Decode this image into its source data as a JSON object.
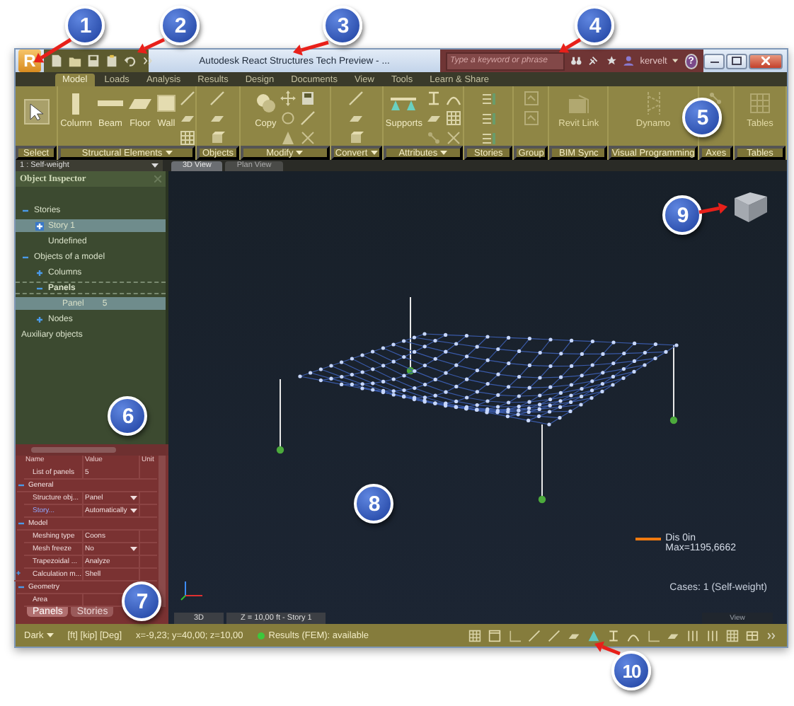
{
  "app_button": {
    "label": "R"
  },
  "window": {
    "title": "Autodesk React Structures Tech Preview - ..."
  },
  "search": {
    "placeholder": "Type a keyword or phrase"
  },
  "user": {
    "name": "kervelt"
  },
  "help": {
    "label": "?"
  },
  "tabs": [
    {
      "label": "Model",
      "selected": true
    },
    {
      "label": "Loads",
      "selected": false
    },
    {
      "label": "Analysis",
      "selected": false
    },
    {
      "label": "Results",
      "selected": false
    },
    {
      "label": "Design",
      "selected": false
    },
    {
      "label": "Documents",
      "selected": false
    },
    {
      "label": "View",
      "selected": false
    },
    {
      "label": "Tools",
      "selected": false
    },
    {
      "label": "Learn & Share",
      "selected": false
    }
  ],
  "ribbon_groups": [
    {
      "label": "Select",
      "menu": false,
      "buttons": [
        {
          "kind": "cursor"
        }
      ]
    },
    {
      "label": "Structural Elements",
      "menu": true,
      "buttons": [
        {
          "kind": "column",
          "label": "Column",
          "disabled": false
        },
        {
          "kind": "beam",
          "label": "Beam",
          "disabled": false
        },
        {
          "kind": "floor",
          "label": "Floor",
          "disabled": false
        },
        {
          "kind": "wall",
          "label": "Wall",
          "disabled": false
        }
      ]
    },
    {
      "label": "Objects",
      "menu": false
    },
    {
      "label": "Modify",
      "menu": true,
      "buttons": [
        {
          "kind": "copy",
          "label": "Copy",
          "disabled": false
        }
      ]
    },
    {
      "label": "Convert",
      "menu": true
    },
    {
      "label": "Attributes",
      "menu": true,
      "buttons": [
        {
          "kind": "supports",
          "label": "Supports",
          "disabled": false
        }
      ]
    },
    {
      "label": "Stories",
      "menu": false
    },
    {
      "label": "Group",
      "menu": false
    },
    {
      "label": "BIM Sync",
      "menu": false,
      "buttons": [
        {
          "kind": "revit",
          "label": "Revit Link",
          "disabled": true
        }
      ]
    },
    {
      "label": "Visual Programming",
      "menu": false,
      "buttons": [
        {
          "kind": "dynamo",
          "label": "Dynamo",
          "disabled": true
        }
      ]
    },
    {
      "label": "Axes",
      "menu": false
    },
    {
      "label": "Tables",
      "menu": false,
      "buttons": [
        {
          "kind": "tables",
          "label": "Tables",
          "disabled": true
        }
      ]
    }
  ],
  "load_case": {
    "value": "1 : Self-weight"
  },
  "view_tabs": [
    {
      "label": "3D View",
      "selected": true
    },
    {
      "label": "Plan View",
      "selected": false
    }
  ],
  "object_inspector": {
    "title": "Object Inspector",
    "tree": [
      {
        "label": "Stories",
        "expanded": true,
        "selected": false,
        "children": [
          {
            "label": "Story 1",
            "expanded": false,
            "selected": true
          },
          {
            "label": "Undefined",
            "selected": false
          }
        ]
      },
      {
        "label": "Objects of a model",
        "expanded": true,
        "selected": false,
        "children": [
          {
            "label": "Columns",
            "expanded": false,
            "selected": false
          },
          {
            "label": "Panels",
            "expanded": true,
            "selected": false,
            "active": true,
            "children": [
              {
                "label": "Panel",
                "count": "5",
                "selected": true
              }
            ]
          },
          {
            "label": "Nodes",
            "expanded": false,
            "selected": false
          }
        ]
      },
      {
        "label": "Auxiliary objects",
        "selected": false
      }
    ]
  },
  "properties": {
    "columns": [
      "Name",
      "Value",
      "Unit"
    ],
    "rows": [
      {
        "kind": "row",
        "name": "List of panels",
        "value": "5",
        "linked": false
      },
      {
        "kind": "section",
        "name": "General",
        "expanded": true
      },
      {
        "kind": "select",
        "name": "Structure obj...",
        "value": "Panel",
        "linked": false
      },
      {
        "kind": "select",
        "name": "Story...",
        "value": "Automatically",
        "linked": true
      },
      {
        "kind": "section",
        "name": "Model",
        "expanded": true
      },
      {
        "kind": "row",
        "name": "Meshing type",
        "value": "Coons",
        "linked": false
      },
      {
        "kind": "select",
        "name": "Mesh freeze",
        "value": "No",
        "linked": false
      },
      {
        "kind": "row",
        "name": "Trapezoidal ...",
        "value": "Analyze",
        "linked": false
      },
      {
        "kind": "row",
        "name": "Calculation m...",
        "value": "Shell",
        "linked": false,
        "expanded": false
      },
      {
        "kind": "section",
        "name": "Geometry",
        "expanded": true
      },
      {
        "kind": "row",
        "name": "Area",
        "linked": false
      }
    ],
    "tabs": [
      {
        "label": "Panels",
        "selected": true
      },
      {
        "label": "Stories",
        "selected": false
      }
    ]
  },
  "viewport": {
    "canvas_tabs": [
      "3D",
      "Z = 10,00 ft - Story 1"
    ],
    "legend": {
      "label": "Dis  0in",
      "max": "Max=1195,6662"
    },
    "cases": "Cases: 1 (Self-weight)",
    "corner_label": "View"
  },
  "status_bar": {
    "theme": "Dark",
    "units": "[ft] [kip] [Deg]",
    "coordinates": "x=-9,23; y=40,00; z=10,00",
    "results": "Results (FEM): available",
    "results_available": true
  },
  "callouts": [
    "1",
    "2",
    "3",
    "4",
    "5",
    "6",
    "7",
    "8",
    "9",
    "10"
  ]
}
